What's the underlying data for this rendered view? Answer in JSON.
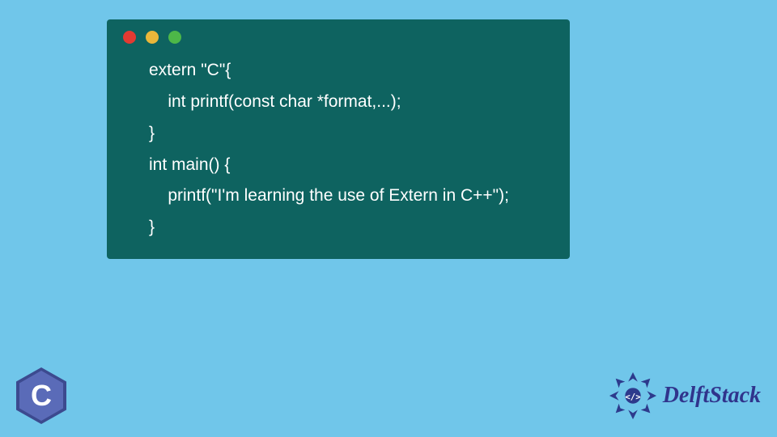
{
  "code": {
    "line1": "extern \"C\"{",
    "line2": "    int printf(const char *format,...);",
    "line3": "}",
    "line4": "int main() {",
    "line5": "    printf(\"I'm learning the use of Extern in C++\");",
    "line6": "}"
  },
  "c_badge": {
    "letter": "C"
  },
  "brand": {
    "name": "DelftStack"
  },
  "colors": {
    "background": "#70c6ea",
    "window": "#0e6360",
    "dot_red": "#e33a32",
    "dot_yellow": "#eab73a",
    "dot_green": "#4db748",
    "brand_text": "#30348c"
  }
}
